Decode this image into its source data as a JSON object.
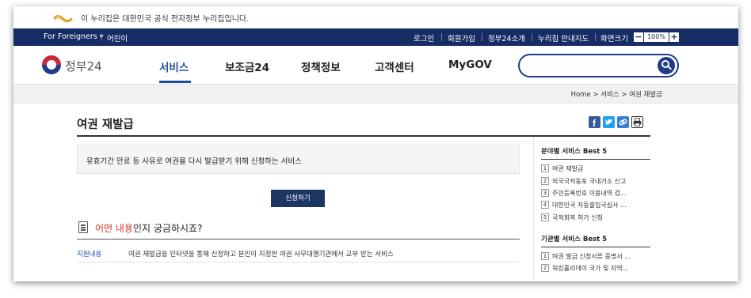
{
  "gov_banner": {
    "text": "이 누리집은 대한민국 공식 전자정부 누리집입니다."
  },
  "topbar": {
    "foreigners": "For Foreigners ▾",
    "kids": "어린이",
    "login": "로그인",
    "signup": "회원가입",
    "about": "정부24소개",
    "sitemap": "누리집 안내지도",
    "screen_size": "화면크기",
    "zoom_minus": "−",
    "zoom_level": "100%",
    "zoom_plus": "+"
  },
  "header": {
    "brand": "정부24",
    "nav": [
      "서비스",
      "보조금24",
      "정책정보",
      "고객센터",
      "MyGOV"
    ],
    "active_nav": 0,
    "search_placeholder": ""
  },
  "breadcrumb": {
    "text": "Home  >  서비스  >  여권 재발급"
  },
  "main": {
    "title": "여권 재발급",
    "summary": "유효기간 만료 등 사유로 여권을 다시 발급받기 위해 신청하는 서비스",
    "apply_button": "신청하기",
    "faq": {
      "prefix": "어떤 내용",
      "suffix": "인지 궁금하시죠?",
      "row_label": "지원내용",
      "row_text": "여권 재발급을 인터넷을 통해 신청하고 본인이 지정한 여권 사무대행기관에서 교부 받는 서비스"
    }
  },
  "share_icons": [
    "facebook-icon",
    "twitter-icon",
    "link-icon",
    "print-icon"
  ],
  "sidebar": {
    "field_title": "분야별 서비스 Best 5",
    "field_items": [
      {
        "num": "1",
        "label": "여권 재발급"
      },
      {
        "num": "2",
        "label": "외국국적동포 국내거소 신고"
      },
      {
        "num": "3",
        "label": "주민등록번호 이용내역 검..."
      },
      {
        "num": "4",
        "label": "대한민국 자동출입국심사 ..."
      },
      {
        "num": "5",
        "label": "국적회복 허가 신청"
      }
    ],
    "agency_title": "기관별 서비스 Best 5",
    "agency_items": [
      {
        "num": "1",
        "label": "여권 발급 신청서류 증명서 ..."
      },
      {
        "num": "2",
        "label": "워킹홀리데이 국가 및 지역..."
      }
    ]
  },
  "colors": {
    "navy": "#152c64",
    "accent_blue": "#1f4fa3",
    "button": "#1d3563",
    "red": "#d03a2b"
  }
}
